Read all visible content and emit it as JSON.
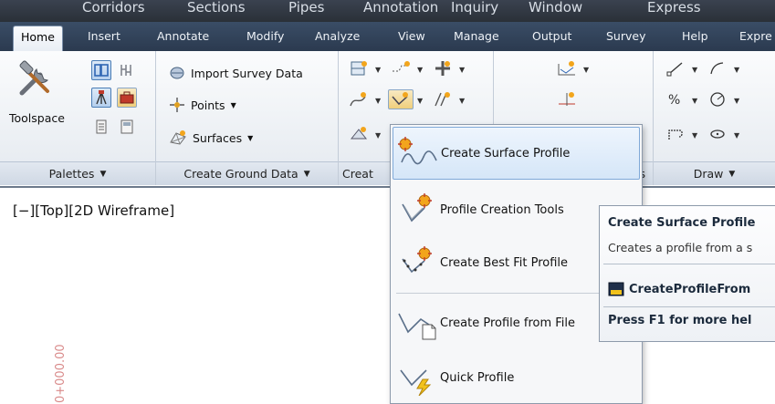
{
  "menubar": {
    "items": [
      "Corridors",
      "Sections",
      "Pipes",
      "Annotation",
      "Inquiry",
      "Window",
      "Express"
    ]
  },
  "ribbon_tabs": [
    "Home",
    "Insert",
    "Annotate",
    "Modify",
    "Analyze",
    "View",
    "Manage",
    "Output",
    "Survey",
    "Help",
    "Expre"
  ],
  "active_tab": "Home",
  "panels": {
    "palettes": {
      "title": "Palettes",
      "toolspace_label": "Toolspace"
    },
    "ground_data": {
      "title": "Create Ground Data",
      "import_survey": "Import Survey Data",
      "points": "Points",
      "surfaces": "Surfaces"
    },
    "create_design": {
      "title": "Creat"
    },
    "profile_view_stub": {
      "title": "s"
    },
    "draw": {
      "title": "Draw"
    }
  },
  "viewport": {
    "label": "[−][Top][2D Wireframe]"
  },
  "station_label": "0+000.00",
  "dropdown": {
    "items": [
      {
        "label": "Create Surface Profile",
        "icon": "surface-profile-icon"
      },
      {
        "label": "Profile Creation Tools",
        "icon": "profile-creation-tools-icon"
      },
      {
        "label": "Create Best Fit Profile",
        "icon": "best-fit-profile-icon"
      },
      {
        "label": "Create Profile from File",
        "icon": "profile-from-file-icon"
      },
      {
        "label": "Quick Profile",
        "icon": "quick-profile-icon"
      }
    ]
  },
  "tooltip": {
    "title": "Create Surface Profile",
    "description": "Creates a profile from a s",
    "command": "CreateProfileFrom",
    "help": "Press F1 for more hel"
  },
  "colors": {
    "ribbon_tab_bg": "#2b3a4f",
    "highlight": "#d5e6f8",
    "accent_star": "#f2a51c"
  }
}
